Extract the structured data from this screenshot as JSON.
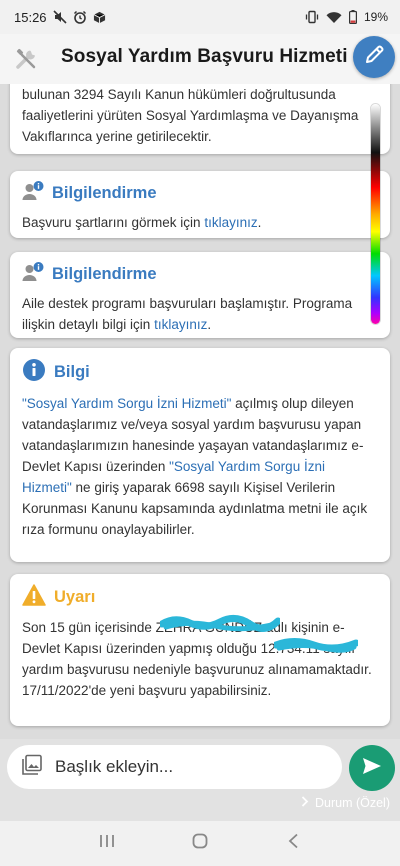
{
  "status_bar": {
    "time": "15:26",
    "battery": "19%",
    "icons_left": [
      "mute-icon",
      "alarm-icon",
      "package-icon"
    ],
    "icons_right": [
      "vibrate-icon",
      "wifi-icon",
      "battery-icon"
    ]
  },
  "header": {
    "title": "Sosyal Yardım Başvuru Hizmeti",
    "left_icon": "tools-icon",
    "fab_icon": "pencil-icon",
    "fab_color": "#3f7fc1"
  },
  "cards": {
    "intro": {
      "text": "bulunan 3294 Sayılı Kanun hükümleri doğrultusunda faaliyetlerini yürüten Sosyal Yardımlaşma ve Dayanışma Vakıflarınca yerine getirilecektir."
    },
    "info1": {
      "title": "Bilgilendirme",
      "text_before": "Başvuru şartlarını görmek için ",
      "link": "tıklayınız",
      "text_after": "."
    },
    "info2": {
      "title": "Bilgilendirme",
      "text_before": "Aile destek programı başvuruları başlamıştır. Programa ilişkin detaylı bilgi için ",
      "link": "tıklayınız",
      "text_after": "."
    },
    "bilgi": {
      "title": "Bilgi",
      "highlight1": "\"Sosyal Yardım Sorgu İzni Hizmeti\"",
      "text1": " açılmış olup dileyen vatandaşlarımız ve/veya sosyal yardım başvurusu yapan vatandaşlarımızın hanesinde yaşayan vatandaşlarımız e-Devlet Kapısı üzerinden ",
      "highlight2": "\"Sosyal Yardım Sorgu İzni Hizmeti\"",
      "text2": " ne giriş yaparak 6698 sayılı Kişisel Verilerin Korunması Kanunu kapsamında aydınlatma metni ile açık rıza formunu onaylayabilirler."
    },
    "uyari": {
      "title": "Uyarı",
      "text_a": "Son 15 gün içerisinde ",
      "redacted_name": "ZEHRA GÜNDÜZ",
      "text_b": " adlı kişinin e-Devlet Kapısı üzerinden yapmış olduğu ",
      "redacted_number": "12.734.11",
      "text_c": " sayılı yardım başvurusu nedeniyle başvurunuz alınamamaktadır. 17/11/2022'de yeni başvuru yapabilirsiniz."
    }
  },
  "compose": {
    "placeholder": "Başlık ekleyin...",
    "status_label": "Durum (Özel)",
    "send_color": "#1a9c74"
  },
  "colors": {
    "accent_blue": "#3a7bc0",
    "warning_orange": "#f0ad2a",
    "scribble": "#2bb7d9"
  }
}
